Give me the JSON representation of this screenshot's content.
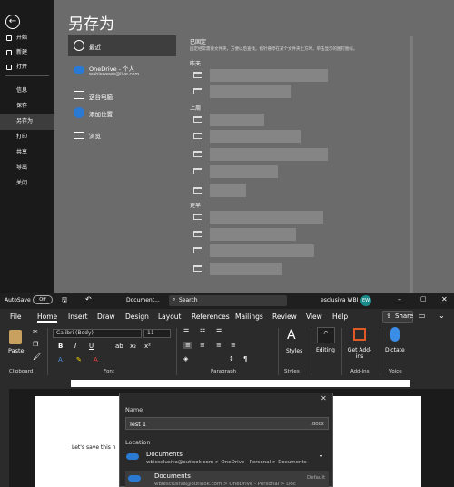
{
  "backstage": {
    "title": "另存为",
    "nav": [
      "开始",
      "新建",
      "打开",
      "信息",
      "保存",
      "另存为",
      "打印",
      "共享",
      "导出",
      "关闭"
    ],
    "locations": [
      {
        "label": "最近",
        "sub": ""
      },
      {
        "label": "OneDrive - 个人",
        "sub": "wahlewewe@live.com"
      },
      {
        "label": "这台电脑",
        "sub": ""
      },
      {
        "label": "添加位置",
        "sub": ""
      },
      {
        "label": "浏览",
        "sub": ""
      }
    ],
    "pinned_header": "已固定",
    "pinned_desc": "固定经常需要文件夹，方便以后查找。指针悬停在某个文件夹上方时，单击显示的图钉图标。",
    "sections": [
      "昨天",
      "上周",
      "更早"
    ]
  },
  "word": {
    "autosave": "AutoSave",
    "autosave_state": "Off",
    "doc_name": "Document...",
    "search": "Search",
    "user": "esclusiva WBI",
    "user_initials": "EW",
    "menu": [
      "File",
      "Home",
      "Insert",
      "Draw",
      "Design",
      "Layout",
      "References",
      "Mailings",
      "Review",
      "View",
      "Help"
    ],
    "share": "Share",
    "font": "Calibri (Body)",
    "size": "11",
    "groups": [
      "Clipboard",
      "Font",
      "Paragraph",
      "Styles",
      "Add-ins",
      "Voice"
    ],
    "paste": "Paste",
    "styles": "Styles",
    "editing": "Editing",
    "get_addins": "Get Add-ins",
    "dictate": "Dictate",
    "page_text": "Let's save this n"
  },
  "dialog": {
    "name_label": "Name",
    "name_value": "Test 1",
    "ext": ".docx",
    "location_label": "Location",
    "loc1_title": "Documents",
    "loc1_sub": "wbiesclusiva@outlook.com > OneDrive - Personal > Documents",
    "loc2_title": "Documents",
    "loc2_sub": "wbiesclusiva@outlook.com > OneDrive - Personal > Doc",
    "loc2_badge": "Default",
    "close": "✕"
  },
  "colors": {
    "accent": "#2a7ad4",
    "backstage_bg": "#6b6b6b",
    "nav_bg": "#1a1a1a"
  }
}
